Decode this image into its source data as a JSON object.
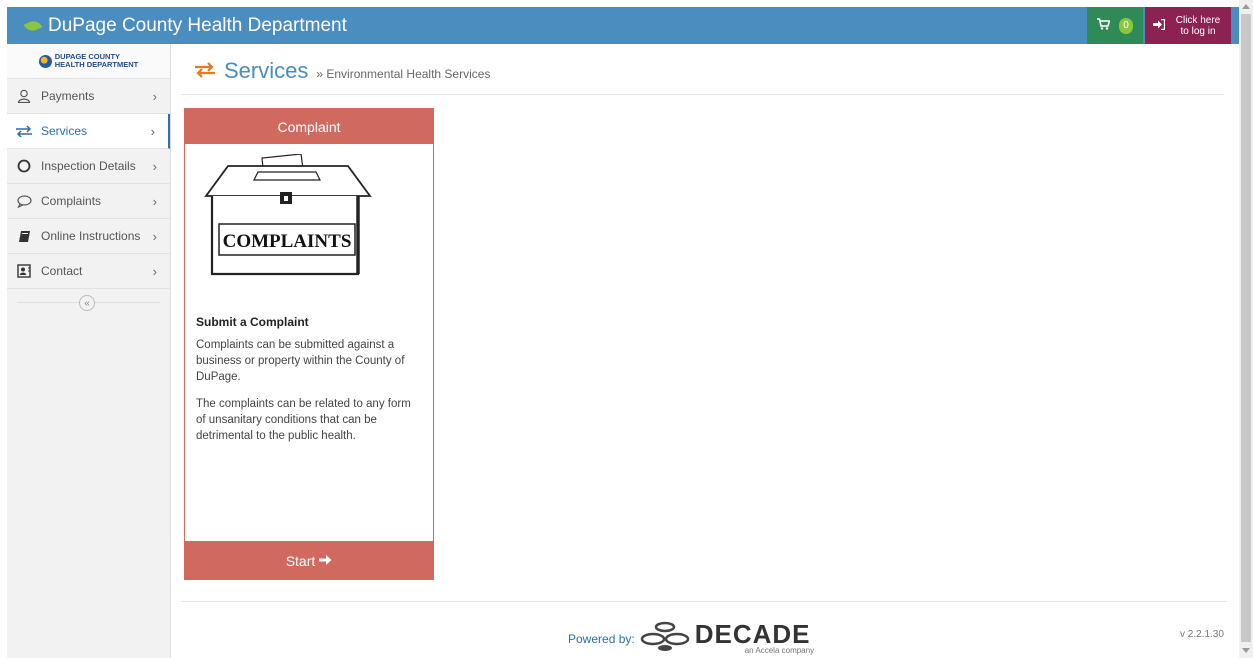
{
  "app": {
    "title": "DuPage County Health Department",
    "accent": "#4a8dbe",
    "leaf_icon": "leaf-icon"
  },
  "header": {
    "cart_count": "0",
    "cart_icon": "cart-icon",
    "login_label_line1": "Click here",
    "login_label_line2": "to log in",
    "login_icon": "sign-in-icon",
    "cart_color": "#2e8b57",
    "login_color": "#8b2252"
  },
  "sidebar": {
    "logo_line1": "DUPAGE COUNTY",
    "logo_line2": "HEALTH DEPARTMENT",
    "items": [
      {
        "label": "Payments",
        "icon": "user-icon"
      },
      {
        "label": "Services",
        "icon": "exchange-icon",
        "active": true
      },
      {
        "label": "Inspection Details",
        "icon": "circle-icon"
      },
      {
        "label": "Complaints",
        "icon": "speech-bubble-icon"
      },
      {
        "label": "Online Instructions",
        "icon": "book-icon"
      },
      {
        "label": "Contact",
        "icon": "contact-card-icon"
      }
    ],
    "collapse_glyph": "«"
  },
  "main": {
    "title": "Services",
    "breadcrumb": "» Environmental Health Services",
    "card": {
      "title": "Complaint",
      "image_text": "COMPLAINTS",
      "heading": "Submit a Complaint",
      "paragraph1": "Complaints can be submitted against a business or property within the County of DuPage.",
      "paragraph2": "The complaints can be related to any form of unsanitary conditions that can be detrimental to the public health.",
      "start_label": "Start",
      "color": "#d06a5f"
    }
  },
  "footer": {
    "powered_by": "Powered by:",
    "brand": "DECADE",
    "brand_sub": "an Accela company",
    "version": "v 2.2.1.30"
  }
}
